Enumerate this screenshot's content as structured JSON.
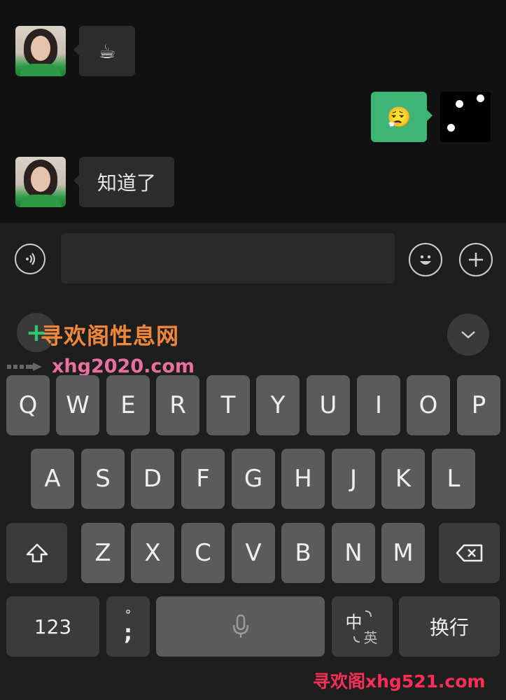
{
  "chat": {
    "messages": [
      {
        "side": "left",
        "content": "☕"
      },
      {
        "side": "right",
        "content": "😮‍💨"
      },
      {
        "side": "left",
        "content": "知道了"
      }
    ],
    "dice_value": 3
  },
  "input": {
    "value": "",
    "placeholder": ""
  },
  "watermarks": {
    "badge": "+",
    "title": "寻欢阁性息网",
    "url": "xhg2020.com",
    "footer": "寻欢阁xhg521.com"
  },
  "keyboard": {
    "row1": [
      "Q",
      "W",
      "E",
      "R",
      "T",
      "Y",
      "U",
      "I",
      "O",
      "P"
    ],
    "row2": [
      "A",
      "S",
      "D",
      "F",
      "G",
      "H",
      "J",
      "K",
      "L"
    ],
    "row3": [
      "Z",
      "X",
      "C",
      "V",
      "B",
      "N",
      "M"
    ],
    "numbers_label": "123",
    "punct_top": "°",
    "punct_bottom": ";",
    "lang_main": "中",
    "lang_sub": "英",
    "enter_label": "换行",
    "icons": {
      "shift": "shift-icon",
      "backspace": "backspace-icon",
      "mic": "microphone-icon",
      "voice": "voice-icon",
      "emoji": "emoji-icon",
      "plus": "plus-icon",
      "collapse": "chevron-down-icon"
    }
  },
  "colors": {
    "background": "#111111",
    "bubble_incoming": "#2c2c2c",
    "bubble_outgoing": "#3eb575",
    "keyboard_bg": "#1e1e1e",
    "key": "#5b5b5b",
    "key_function": "#3b3b3b"
  }
}
